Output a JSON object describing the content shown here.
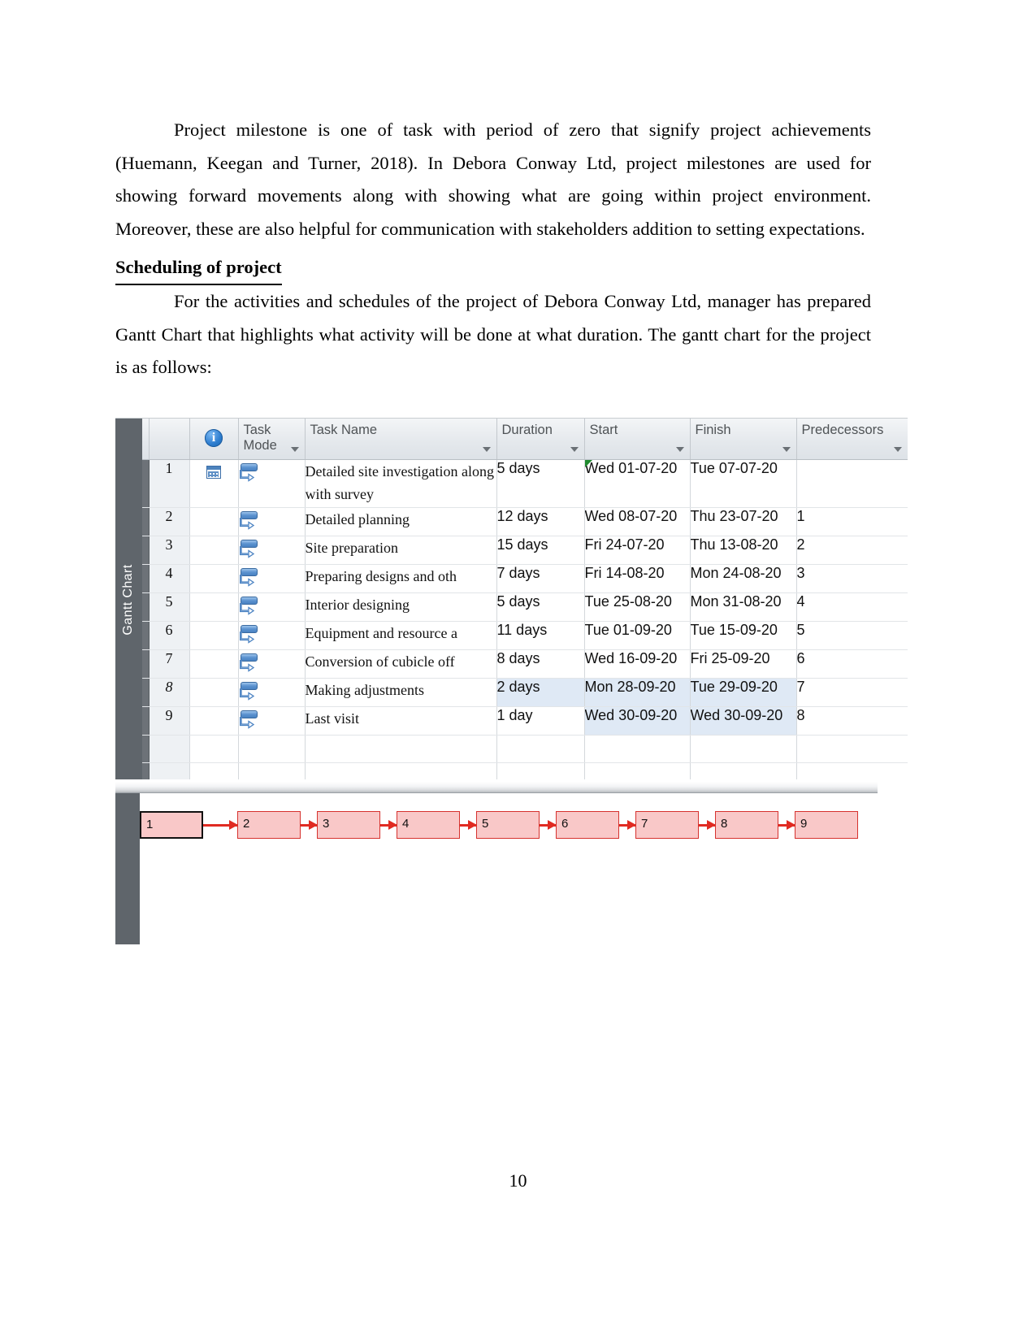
{
  "document": {
    "paragraph_1": "Project milestone is one of task with period of zero that signify project achievements (Huemann, Keegan and Turner, 2018). In Debora Conway Ltd, project milestones are used for showing forward movements along with showing what are going within project environment. Moreover, these are also helpful for communication with stakeholders addition to setting expectations.",
    "heading_1": "Scheduling of project",
    "paragraph_2": "For the activities and schedules of the project of Debora Conway Ltd, manager has prepared Gantt Chart that highlights what activity will be done at what duration. The gantt chart for the project is as follows:",
    "page_number": "10"
  },
  "gantt": {
    "view_label": "Gantt Chart",
    "columns": {
      "id": "",
      "indicators": "info-icon",
      "task_mode_line1": "Task",
      "task_mode_line2": "Mode",
      "task_name": "Task Name",
      "duration": "Duration",
      "start": "Start",
      "finish": "Finish",
      "predecessors": "Predecessors"
    },
    "rows": [
      {
        "id": "1",
        "name": "Detailed site investigation along with survey",
        "duration": "5 days",
        "start": "Wed 01-07-20",
        "finish": "Tue 07-07-20",
        "predecessors": ""
      },
      {
        "id": "2",
        "name": "Detailed planning",
        "duration": "12 days",
        "start": "Wed 08-07-20",
        "finish": "Thu 23-07-20",
        "predecessors": "1"
      },
      {
        "id": "3",
        "name": "Site preparation",
        "duration": "15 days",
        "start": "Fri 24-07-20",
        "finish": "Thu 13-08-20",
        "predecessors": "2"
      },
      {
        "id": "4",
        "name": "Preparing designs and oth",
        "duration": "7 days",
        "start": "Fri 14-08-20",
        "finish": "Mon 24-08-20",
        "predecessors": "3"
      },
      {
        "id": "5",
        "name": "Interior designing",
        "duration": "5 days",
        "start": "Tue 25-08-20",
        "finish": "Mon 31-08-20",
        "predecessors": "4"
      },
      {
        "id": "6",
        "name": "Equipment and resource a",
        "duration": "11 days",
        "start": "Tue 01-09-20",
        "finish": "Tue 15-09-20",
        "predecessors": "5"
      },
      {
        "id": "7",
        "name": "Conversion of cubicle off",
        "duration": "8 days",
        "start": "Wed 16-09-20",
        "finish": "Fri 25-09-20",
        "predecessors": "6"
      },
      {
        "id": "8",
        "name": "Making adjustments",
        "duration": "2 days",
        "start": "Mon 28-09-20",
        "finish": "Tue 29-09-20",
        "predecessors": "7"
      },
      {
        "id": "9",
        "name": "Last visit",
        "duration": "1 day",
        "start": "Wed 30-09-20",
        "finish": "Wed 30-09-20",
        "predecessors": "8"
      }
    ]
  },
  "network_diagram": {
    "nodes": [
      "1",
      "2",
      "3",
      "4",
      "5",
      "6",
      "7",
      "8",
      "9"
    ]
  },
  "colors": {
    "node_fill": "#f9c8c8",
    "node_border": "#d6322e",
    "connector": "#e02b22",
    "selection": "#dfe9f5",
    "view_strip": "#5f656b",
    "task_mode_icon": "#5b92cf"
  }
}
